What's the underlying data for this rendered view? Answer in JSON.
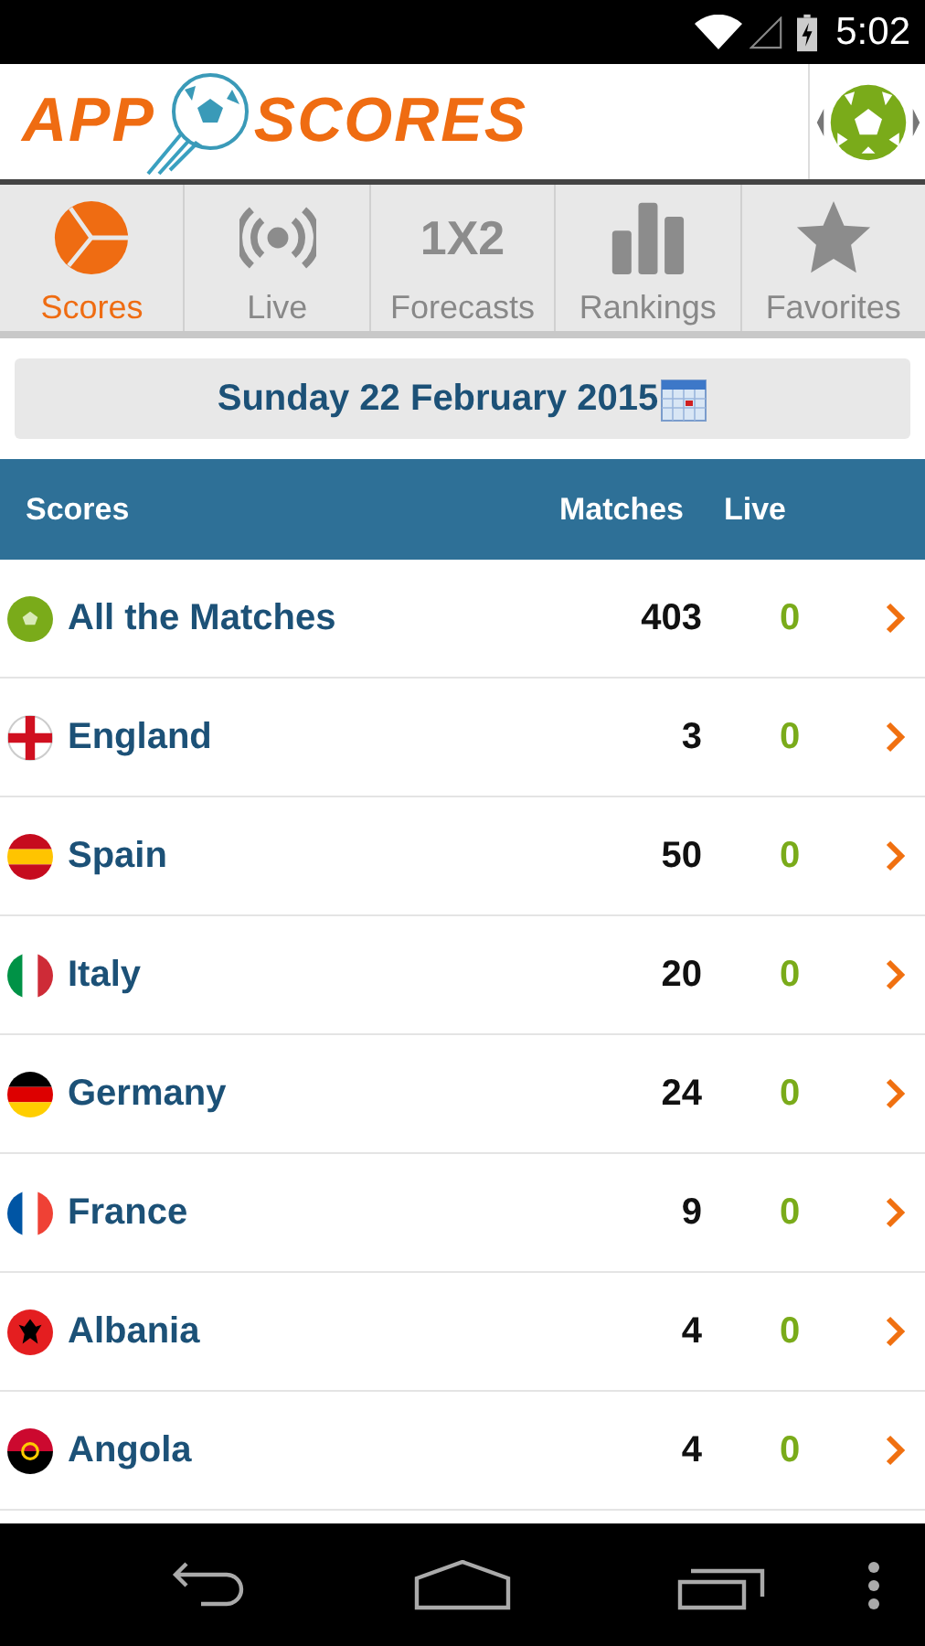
{
  "status_bar": {
    "time": "5:02"
  },
  "logo": {
    "left": "APP",
    "right": "SCORES"
  },
  "tabs": [
    {
      "label": "Scores",
      "kind": "pie",
      "selected": true
    },
    {
      "label": "Live",
      "kind": "live",
      "selected": false
    },
    {
      "label": "Forecasts",
      "kind": "text",
      "glyph": "1X2",
      "selected": false
    },
    {
      "label": "Rankings",
      "kind": "bars",
      "selected": false
    },
    {
      "label": "Favorites",
      "kind": "star",
      "selected": false
    }
  ],
  "date": "Sunday 22 February 2015",
  "table": {
    "columns": [
      "Scores",
      "Matches",
      "Live"
    ],
    "rows": [
      {
        "name": "All the Matches",
        "kind": "ball",
        "matches": "403",
        "live": "0"
      },
      {
        "name": "England",
        "kind": "england",
        "matches": "3",
        "live": "0"
      },
      {
        "name": "Spain",
        "kind": "spain",
        "matches": "50",
        "live": "0"
      },
      {
        "name": "Italy",
        "kind": "italy",
        "matches": "20",
        "live": "0"
      },
      {
        "name": "Germany",
        "kind": "germany",
        "matches": "24",
        "live": "0"
      },
      {
        "name": "France",
        "kind": "france",
        "matches": "9",
        "live": "0"
      },
      {
        "name": "Albania",
        "kind": "albania",
        "matches": "4",
        "live": "0"
      },
      {
        "name": "Angola",
        "kind": "angola",
        "matches": "4",
        "live": "0"
      }
    ]
  }
}
